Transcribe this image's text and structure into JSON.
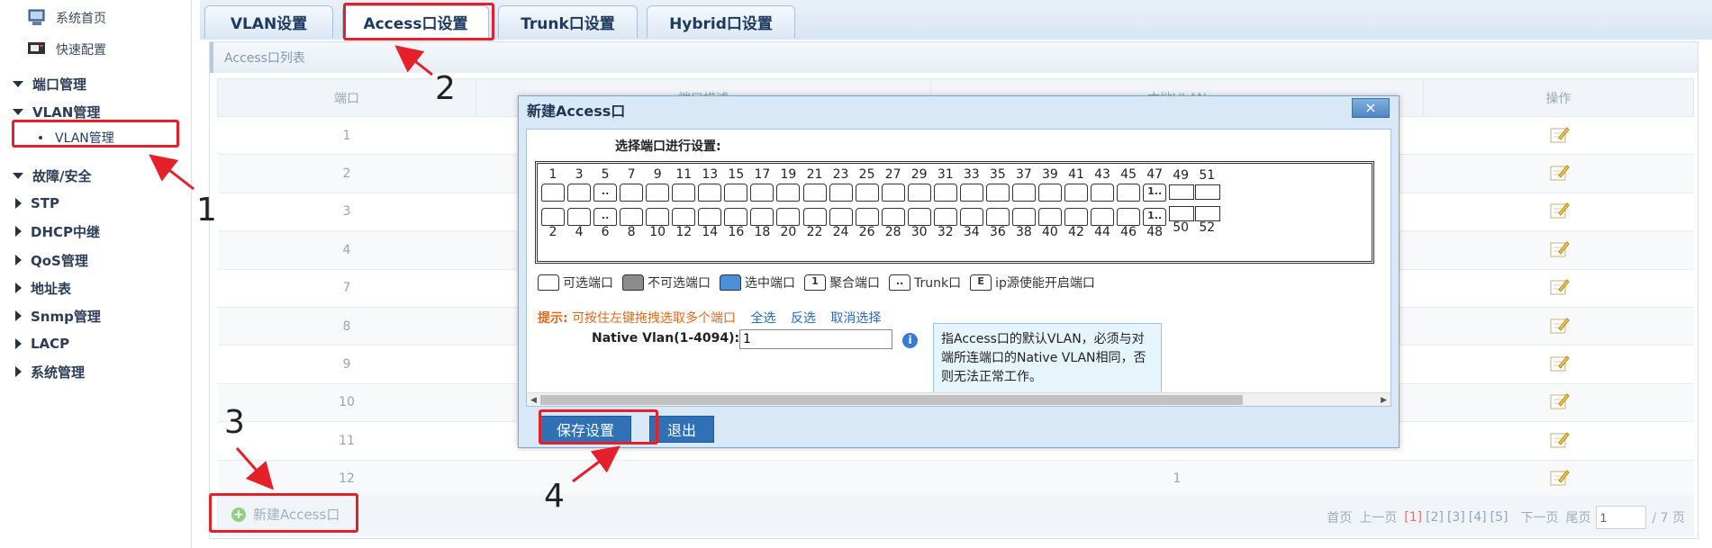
{
  "sidebar": {
    "top_items": [
      {
        "label": "系统首页",
        "icon": "computer-icon"
      },
      {
        "label": "快速配置",
        "icon": "monitor-icon"
      }
    ],
    "sections": [
      {
        "label": "端口管理",
        "expanded": true
      },
      {
        "label": "VLAN管理",
        "expanded": true
      },
      {
        "label": "故障/安全",
        "expanded": true
      },
      {
        "label": "STP",
        "expanded": false
      },
      {
        "label": "DHCP中继",
        "expanded": false
      },
      {
        "label": "QoS管理",
        "expanded": false
      },
      {
        "label": "地址表",
        "expanded": false
      },
      {
        "label": "Snmp管理",
        "expanded": false
      },
      {
        "label": "LACP",
        "expanded": false
      },
      {
        "label": "系统管理",
        "expanded": false
      }
    ],
    "sub_item": "VLAN管理"
  },
  "tabs": [
    "VLAN设置",
    "Access口设置",
    "Trunk口设置",
    "Hybrid口设置"
  ],
  "active_tab": "Access口设置",
  "panel": {
    "title": "Access口列表",
    "columns": [
      "端口",
      "端口描述",
      "本地VLAN",
      "操作"
    ],
    "rows": [
      {
        "port": "1",
        "vlan": ""
      },
      {
        "port": "2",
        "vlan": ""
      },
      {
        "port": "3",
        "vlan": ""
      },
      {
        "port": "4",
        "vlan": ""
      },
      {
        "port": "7",
        "vlan": ""
      },
      {
        "port": "8",
        "vlan": ""
      },
      {
        "port": "9",
        "vlan": ""
      },
      {
        "port": "10",
        "vlan": ""
      },
      {
        "port": "11",
        "vlan": ""
      },
      {
        "port": "12",
        "vlan": "1"
      }
    ],
    "new_button": "新建Access口",
    "pager": {
      "first": "首页",
      "prev": "上一页",
      "pages": [
        "[1]",
        "[2]",
        "[3]",
        "[4]",
        "[5]"
      ],
      "next": "下一页",
      "last": "尾页",
      "page_input": "1",
      "total": "/ 7 页"
    }
  },
  "dialog": {
    "title": "新建Access口",
    "close": "×",
    "select_label": "选择端口进行设置:",
    "top_numbers": [
      "1",
      "3",
      "5",
      "7",
      "9",
      "11",
      "13",
      "15",
      "17",
      "19",
      "21",
      "23",
      "25",
      "27",
      "29",
      "31",
      "33",
      "35",
      "37",
      "39",
      "41",
      "43",
      "45",
      "47",
      "49",
      "51"
    ],
    "bottom_numbers": [
      "2",
      "4",
      "6",
      "8",
      "10",
      "12",
      "14",
      "16",
      "18",
      "20",
      "22",
      "24",
      "26",
      "28",
      "30",
      "32",
      "34",
      "36",
      "38",
      "40",
      "42",
      "44",
      "46",
      "48",
      "50",
      "52"
    ],
    "port_marks": {
      "5": "..",
      "6": "..",
      "47": "1..",
      "48": "1.."
    },
    "legend": [
      {
        "label": "可选端口",
        "sw": "",
        "kind": "avail"
      },
      {
        "label": "不可选端口",
        "sw": "",
        "kind": "disabled"
      },
      {
        "label": "选中端口",
        "sw": "",
        "kind": "selected"
      },
      {
        "label": "聚合端口",
        "sw": "1",
        "kind": "lag"
      },
      {
        "label": "Trunk口",
        "sw": "..",
        "kind": "trunk"
      },
      {
        "label": "ip源使能开启端口",
        "sw": "E",
        "kind": "ipsrc"
      }
    ],
    "tip_prefix": "提示:",
    "tip_text": "可按住左键拖拽选取多个端口",
    "select_all": "全选",
    "invert": "反选",
    "cancel_select": "取消选择",
    "native_vlan_label": "Native Vlan(1-4094):",
    "native_vlan_value": "1",
    "info": "i",
    "tooltip": "指Access口的默认VLAN，必须与对端所连端口的Native VLAN相同，否则无法正常工作。",
    "save": "保存设置",
    "exit": "退出"
  },
  "annotations": [
    "1",
    "2",
    "3",
    "4"
  ],
  "colors": {
    "annotation": "#e5202b",
    "accent": "#2f71b4",
    "tip": "#e06a1c"
  }
}
